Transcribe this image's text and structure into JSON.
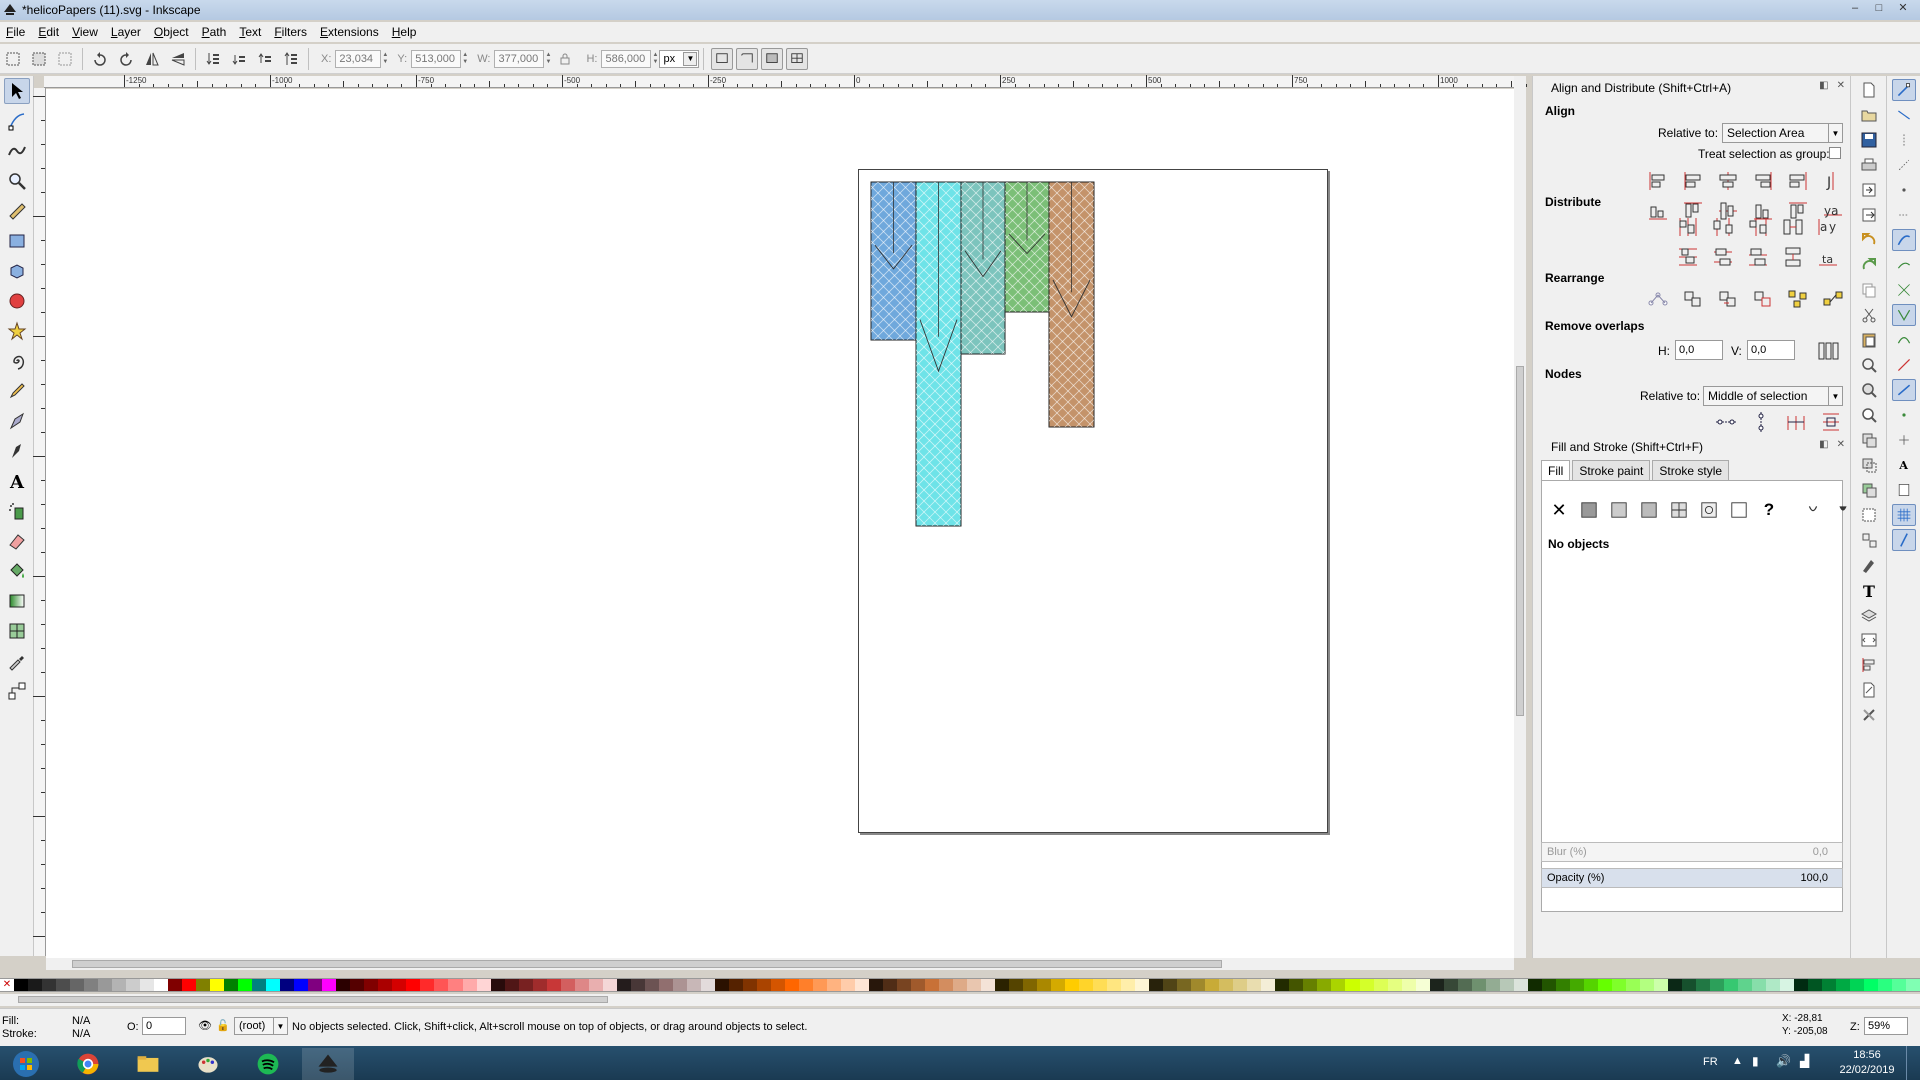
{
  "window": {
    "title": "*helicoPapers (11).svg - Inkscape",
    "controls": [
      "–",
      "□",
      "✕"
    ]
  },
  "menu": [
    "File",
    "Edit",
    "View",
    "Layer",
    "Object",
    "Path",
    "Text",
    "Filters",
    "Extensions",
    "Help"
  ],
  "toolcontrols": {
    "x_label": "X:",
    "x_value": "23,034",
    "y_label": "Y:",
    "y_value": "513,000",
    "w_label": "W:",
    "w_value": "377,000",
    "h_label": "H:",
    "h_value": "586,000",
    "unit": "px"
  },
  "ruler_labels": [
    "-1250",
    "-1000",
    "-750",
    "-500",
    "-250",
    "0",
    "250",
    "500",
    "750",
    "1000"
  ],
  "align_panel": {
    "title": "Align and Distribute (Shift+Ctrl+A)",
    "align_label": "Align",
    "relative_to_label": "Relative to:",
    "relative_to_value": "Selection Area",
    "treat_group_label": "Treat selection as group:",
    "distribute_label": "Distribute",
    "rearrange_label": "Rearrange",
    "remove_overlaps_label": "Remove overlaps",
    "h_label": "H:",
    "h_value": "0,0",
    "v_label": "V:",
    "v_value": "0,0",
    "nodes_label": "Nodes",
    "nodes_relative_label": "Relative to:",
    "nodes_relative_value": "Middle of selection"
  },
  "fill_panel": {
    "title": "Fill and Stroke (Shift+Ctrl+F)",
    "tabs": [
      "Fill",
      "Stroke paint",
      "Stroke style"
    ],
    "no_objects": "No objects",
    "blur_label": "Blur (%)",
    "blur_value": "0,0",
    "opacity_label": "Opacity (%)",
    "opacity_value": "100,0"
  },
  "status": {
    "fill_label": "Fill:",
    "fill_value": "N/A",
    "stroke_label": "Stroke:",
    "stroke_value": "N/A",
    "o_label": "O:",
    "o_value": "0",
    "layer": "(root)",
    "message": "No objects selected. Click, Shift+click, Alt+scroll mouse on top of objects, or drag around objects to select.",
    "x_coord": "X: -28,81",
    "y_coord": "Y: -205,08",
    "zoom_label": "Z:",
    "zoom": "59%"
  },
  "taskbar": {
    "lang": "FR",
    "time": "18:56",
    "date": "22/02/2019"
  },
  "colors": {
    "blue": "#6fa8dc",
    "cyan": "#6ee3e8",
    "teal": "#7cc4bd",
    "green": "#7bbf77",
    "brown": "#c4936a"
  }
}
